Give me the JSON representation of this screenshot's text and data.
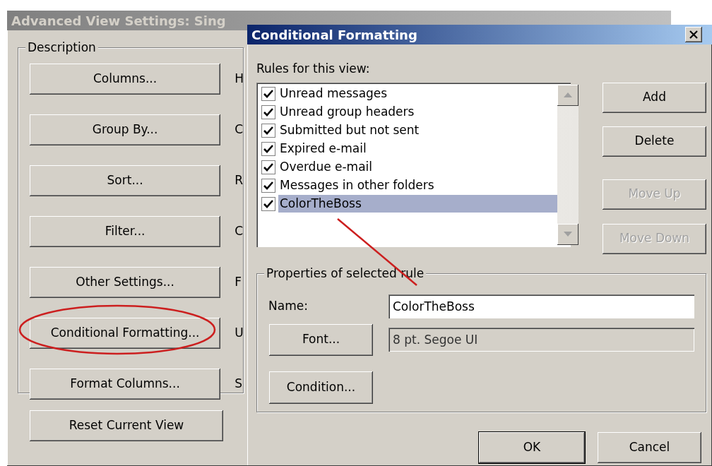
{
  "background_window": {
    "title": "Advanced View Settings: Sing",
    "group_label": "Description",
    "buttons": [
      {
        "label": "Columns...",
        "summary": "H"
      },
      {
        "label": "Group By...",
        "summary": "C"
      },
      {
        "label": "Sort...",
        "summary": "R"
      },
      {
        "label": "Filter...",
        "summary": "C"
      },
      {
        "label": "Other Settings...",
        "summary": "F"
      },
      {
        "label": "Conditional Formatting...",
        "summary": "U"
      },
      {
        "label": "Format Columns...",
        "summary": "S"
      }
    ],
    "reset_button": "Reset Current View"
  },
  "dialog": {
    "title": "Conditional Formatting",
    "rules_label": "Rules for this view:",
    "rules": [
      {
        "label": "Unread messages",
        "checked": true,
        "selected": false
      },
      {
        "label": "Unread group headers",
        "checked": true,
        "selected": false
      },
      {
        "label": "Submitted but not sent",
        "checked": true,
        "selected": false
      },
      {
        "label": "Expired e-mail",
        "checked": true,
        "selected": false
      },
      {
        "label": "Overdue e-mail",
        "checked": true,
        "selected": false
      },
      {
        "label": "Messages in other folders",
        "checked": true,
        "selected": false
      },
      {
        "label": "ColorTheBoss",
        "checked": true,
        "selected": true
      }
    ],
    "side_buttons": [
      {
        "label": "Add",
        "disabled": false
      },
      {
        "label": "Delete",
        "disabled": false
      },
      {
        "label": "Move Up",
        "disabled": true
      },
      {
        "label": "Move Down",
        "disabled": true
      }
    ],
    "properties": {
      "label": "Properties of selected rule",
      "name_label": "Name:",
      "name_value": "ColorTheBoss",
      "font_button": "Font...",
      "font_value": "8 pt. Segoe UI",
      "condition_button": "Condition..."
    },
    "ok": "OK",
    "cancel": "Cancel"
  },
  "annotations": [
    {
      "kind": "ellipse"
    },
    {
      "kind": "line"
    }
  ]
}
